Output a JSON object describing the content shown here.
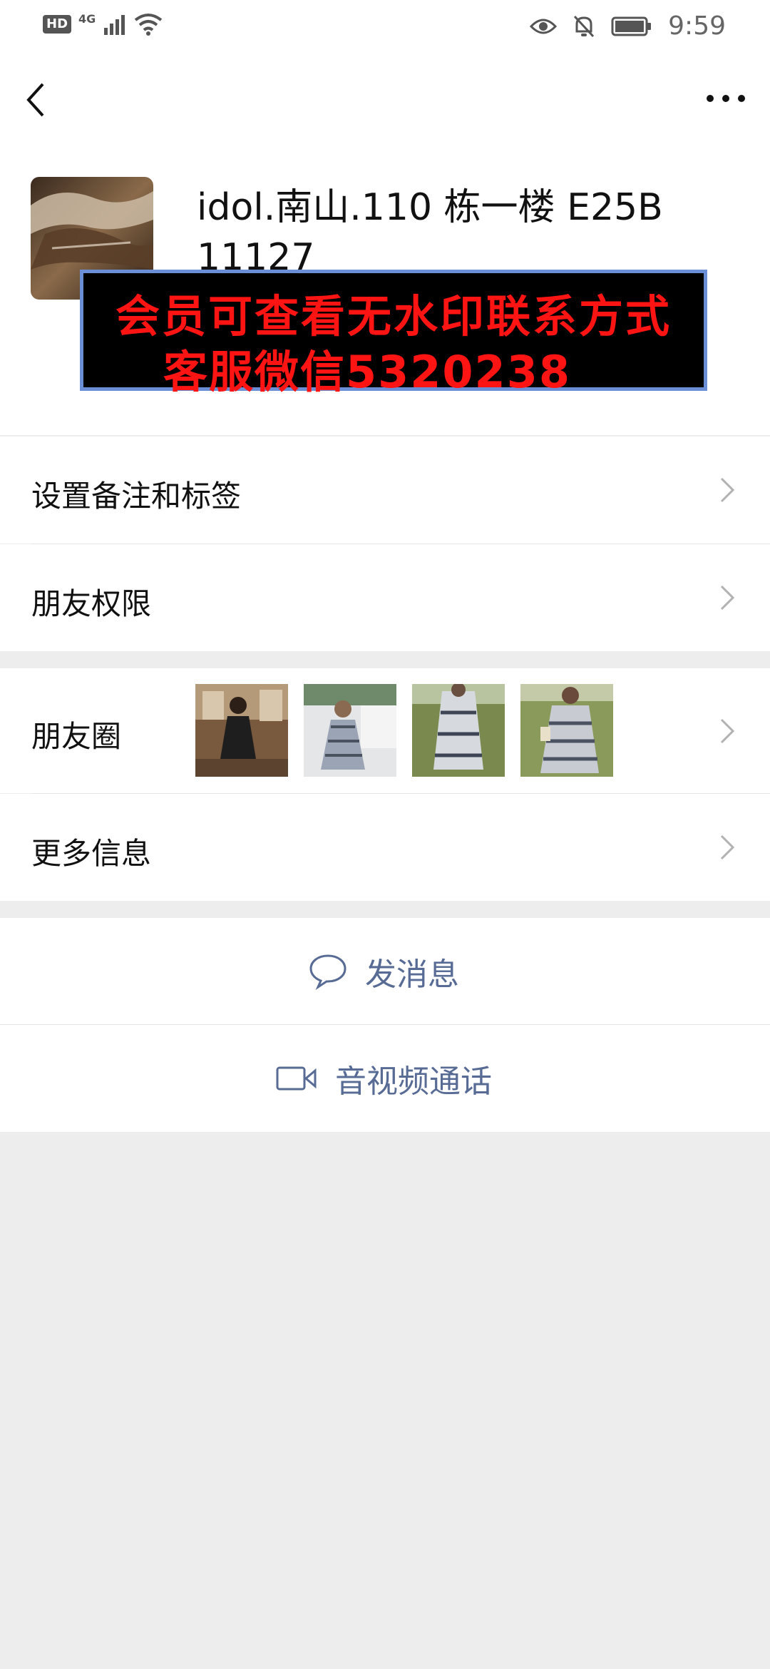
{
  "status_bar": {
    "hd": "HD",
    "network": "4G",
    "time": "9:59"
  },
  "profile": {
    "name_line1": "idol.南山.110 栋一楼 E25B",
    "name_line2": "11127",
    "watermark_line1": "会员可查看无水印联系方式",
    "watermark_line2": "客服微信5320238"
  },
  "menu": {
    "remark_label": "设置备注和标签",
    "permission_label": "朋友权限",
    "moments_label": "朋友圈",
    "more_info_label": "更多信息"
  },
  "actions": {
    "message_label": "发消息",
    "video_call_label": "音视频通话"
  },
  "colors": {
    "link_blue": "#576b95",
    "watermark_red": "#ff1414",
    "background": "#ededed"
  }
}
